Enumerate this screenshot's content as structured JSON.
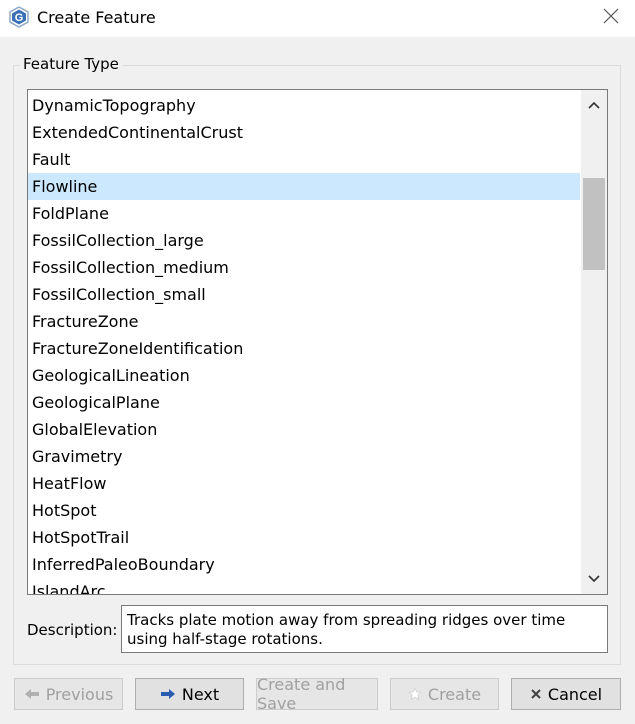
{
  "window": {
    "title": "Create Feature",
    "app_icon": "gplates-g-icon",
    "close_icon": "close-icon"
  },
  "group": {
    "title": "Feature Type"
  },
  "feature_types": {
    "items": [
      "DynamicTopography",
      "ExtendedContinentalCrust",
      "Fault",
      "Flowline",
      "FoldPlane",
      "FossilCollection_large",
      "FossilCollection_medium",
      "FossilCollection_small",
      "FractureZone",
      "FractureZoneIdentification",
      "GeologicalLineation",
      "GeologicalPlane",
      "GlobalElevation",
      "Gravimetry",
      "HeatFlow",
      "HotSpot",
      "HotSpotTrail",
      "InferredPaleoBoundary",
      "IslandArc"
    ],
    "selected": "Flowline",
    "selection_color": "#cce8ff"
  },
  "description": {
    "label": "Description:",
    "text": "Tracks plate motion away from spreading ridges over time using half-stage rotations."
  },
  "buttons": {
    "previous": {
      "label": "Previous",
      "enabled": false,
      "icon": "arrow-left-icon"
    },
    "next": {
      "label": "Next",
      "enabled": true,
      "icon": "arrow-right-icon"
    },
    "create_and_save": {
      "label": "Create and Save",
      "enabled": false
    },
    "create": {
      "label": "Create",
      "enabled": false,
      "icon": "star-icon"
    },
    "cancel": {
      "label": "Cancel",
      "enabled": true,
      "icon": "x-icon"
    }
  }
}
